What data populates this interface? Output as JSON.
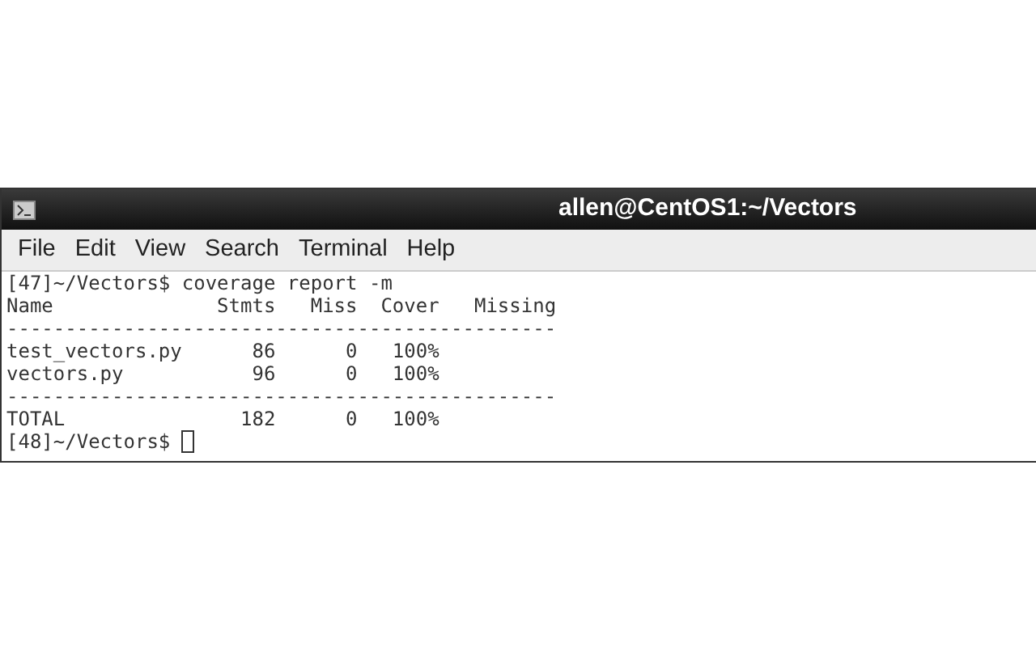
{
  "window": {
    "title": "allen@CentOS1:~/Vectors"
  },
  "menu": [
    "File",
    "Edit",
    "View",
    "Search",
    "Terminal",
    "Help"
  ],
  "terminal": {
    "lines": [
      "[47]~/Vectors$ coverage report -m",
      "Name              Stmts   Miss  Cover   Missing",
      "-----------------------------------------------",
      "test_vectors.py      86      0   100%",
      "vectors.py           96      0   100%",
      "-----------------------------------------------",
      "TOTAL               182      0   100%"
    ],
    "prompt": "[48]~/Vectors$ ",
    "cursor": true
  }
}
